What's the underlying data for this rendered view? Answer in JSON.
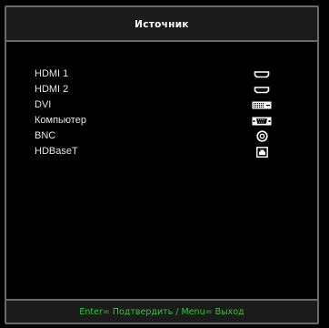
{
  "menu": {
    "title": "Источник"
  },
  "sources": [
    {
      "label": "HDMI 1",
      "icon": "hdmi-port-icon"
    },
    {
      "label": "HDMI 2",
      "icon": "hdmi-port-icon"
    },
    {
      "label": "DVI",
      "icon": "dvi-port-icon"
    },
    {
      "label": "Компьютер",
      "icon": "vga-port-icon"
    },
    {
      "label": "BNC",
      "icon": "bnc-connector-icon"
    },
    {
      "label": "HDBaseT",
      "icon": "hdbaset-port-icon"
    }
  ],
  "footer": {
    "hint": "Enter= Подтвердить / Menu= Выход"
  },
  "colors": {
    "background": "#000000",
    "panel": "#1b1b1b",
    "border": "#6a6a6a",
    "text": "#e6e6e6",
    "hint": "#39c23a"
  }
}
